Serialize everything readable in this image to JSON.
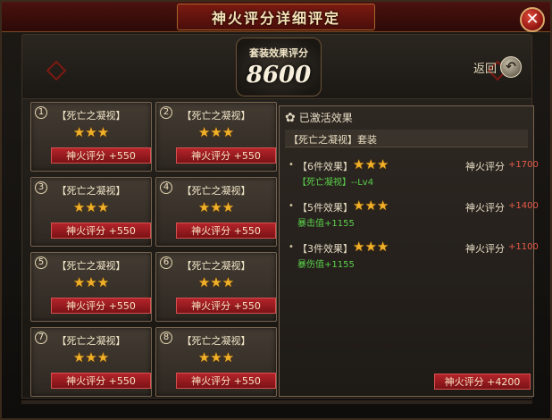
{
  "window": {
    "title": "神火评分详细评定",
    "close_symbol": "✕"
  },
  "summary": {
    "label": "套装效果评分",
    "value": "8600"
  },
  "return_button": {
    "label": "返回",
    "icon": "return-arrow-icon",
    "symbol": "↶"
  },
  "cards": [
    {
      "num": "1",
      "name": "【死亡之凝视】",
      "stars": "★★★",
      "score": "神火评分 +550"
    },
    {
      "num": "2",
      "name": "【死亡之凝视】",
      "stars": "★★★",
      "score": "神火评分 +550"
    },
    {
      "num": "3",
      "name": "【死亡之凝视】",
      "stars": "★★★",
      "score": "神火评分 +550"
    },
    {
      "num": "4",
      "name": "【死亡之凝视】",
      "stars": "★★★",
      "score": "神火评分 +550"
    },
    {
      "num": "5",
      "name": "【死亡之凝视】",
      "stars": "★★★",
      "score": "神火评分 +550"
    },
    {
      "num": "6",
      "name": "【死亡之凝视】",
      "stars": "★★★",
      "score": "神火评分 +550"
    },
    {
      "num": "7",
      "name": "【死亡之凝视】",
      "stars": "★★★",
      "score": "神火评分 +550"
    },
    {
      "num": "8",
      "name": "【死亡之凝视】",
      "stars": "★★★",
      "score": "神火评分 +550"
    }
  ],
  "effects": {
    "header_icon": "flower-icon",
    "header_symbol": "✿",
    "header_label": "已激活效果",
    "set_name": "【死亡之凝视】套装",
    "tiers": [
      {
        "dot": "•",
        "label": "【6件效果】",
        "stars": "★★★",
        "score_label": "神火评分",
        "score_value": "+1700",
        "effect": "【死亡凝视】--Lv4"
      },
      {
        "dot": "•",
        "label": "【5件效果】",
        "stars": "★★★",
        "score_label": "神火评分",
        "score_value": "+1400",
        "effect": "暴击值+1155"
      },
      {
        "dot": "•",
        "label": "【3件效果】",
        "stars": "★★★",
        "score_label": "神火评分",
        "score_value": "+1100",
        "effect": "暴伤值+1155"
      }
    ],
    "total_score": "神火评分 +4200"
  },
  "colors": {
    "title_bar": "#4a120e",
    "star_gold": "#f0b028",
    "score_red": "#b4242a",
    "effect_green": "#5ad04a",
    "bonus_red": "#e65a4a"
  }
}
